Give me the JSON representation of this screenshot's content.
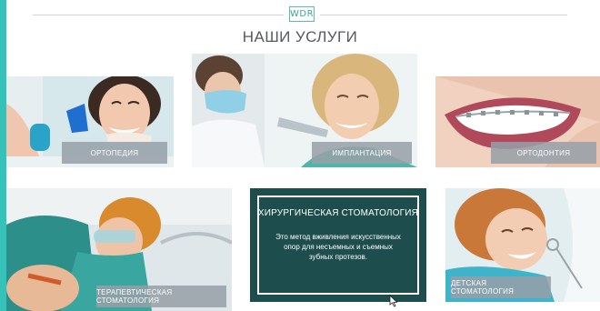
{
  "header": {
    "logo_text": "WDR",
    "title": "НАШИ УСЛУГИ"
  },
  "services": [
    {
      "label": "ОРТОПЕДИЯ",
      "photo": "smiling-woman-with-dental-model"
    },
    {
      "label": "ИМПЛАНТАЦИЯ",
      "photo": "dentist-and-smiling-patient"
    },
    {
      "label": "ОРТОДОНТИЯ",
      "photo": "smile-with-braces"
    },
    {
      "label": "ТЕРАПЕВТИЧЕСКАЯ СТОМАТОЛОГИЯ",
      "photo": "dentist-with-protective-glasses"
    },
    {
      "label": "ДЕТСКАЯ СТОМАТОЛОГИЯ",
      "photo": "smiling-child-at-dentist"
    }
  ],
  "featured": {
    "title": "ХИРУРГИЧЕСКАЯ СТОМАТОЛОГИЯ",
    "description": "Это метод вживления искусственных опор для несъемных и съемных зубных протезов.",
    "background": "#1d4d4c"
  },
  "colors": {
    "accent": "#35c2b8",
    "label_bg": "#96a0a8"
  }
}
